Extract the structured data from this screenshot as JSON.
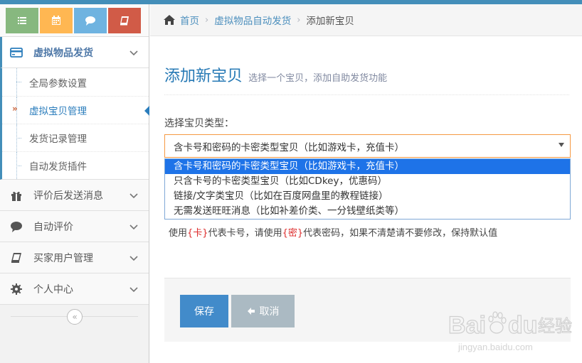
{
  "sidebar": {
    "shortcuts": [
      {
        "icon": "list-icon",
        "color": "#87b87f"
      },
      {
        "icon": "calendar-icon",
        "color": "#ffb752"
      },
      {
        "icon": "chat-icon",
        "color": "#6fb3e0"
      },
      {
        "icon": "book-icon",
        "color": "#d15b47"
      }
    ],
    "menu": {
      "virtual_goods": "虚拟物品发货",
      "sub_items": [
        "全局参数设置",
        "虚拟宝贝管理",
        "发货记录管理",
        "自动发货插件"
      ],
      "after_review": "评价后发送消息",
      "auto_review": "自动评价",
      "buyer_users": "买家用户管理",
      "personal_center": "个人中心"
    },
    "collapse_glyph": "«"
  },
  "breadcrumb": {
    "home": "首页",
    "section": "虚拟物品自动发货",
    "current": "添加新宝贝",
    "separator": "›"
  },
  "page": {
    "title": "添加新宝贝",
    "subtitle": "选择一个宝贝，添加自助发货功能"
  },
  "form": {
    "type_label": "选择宝贝类型：",
    "selected_value": "含卡号和密码的卡密类型宝贝（比如游戏卡，充值卡）",
    "options": [
      "含卡号和密码的卡密类型宝贝（比如游戏卡，充值卡）",
      "只含卡号的卡密类型宝贝（比如CDkey，优惠码）",
      "链接/文字类宝贝（比如在百度网盘里的教程链接）",
      "无需发送旺旺消息（比如补差价类、一分钱壁纸类等）"
    ],
    "help": {
      "part1": "使用",
      "card_token": "{卡}",
      "part2": "代表卡号，请使用",
      "pwd_token": "{密}",
      "part3": "代表密码，如果不清楚请不要修改，保持默认值"
    },
    "save_label": "保存",
    "cancel_label": "取消"
  },
  "watermark": {
    "brand": "Bai",
    "brand2": "du",
    "cn": "经验",
    "url": "jingyan.baidu.com"
  },
  "colors": {
    "accent": "#438eb9",
    "save_button": "#428bca",
    "cancel_button": "#abbac3",
    "select_border": "#f59942",
    "dropdown_highlight": "#1e73e8"
  }
}
